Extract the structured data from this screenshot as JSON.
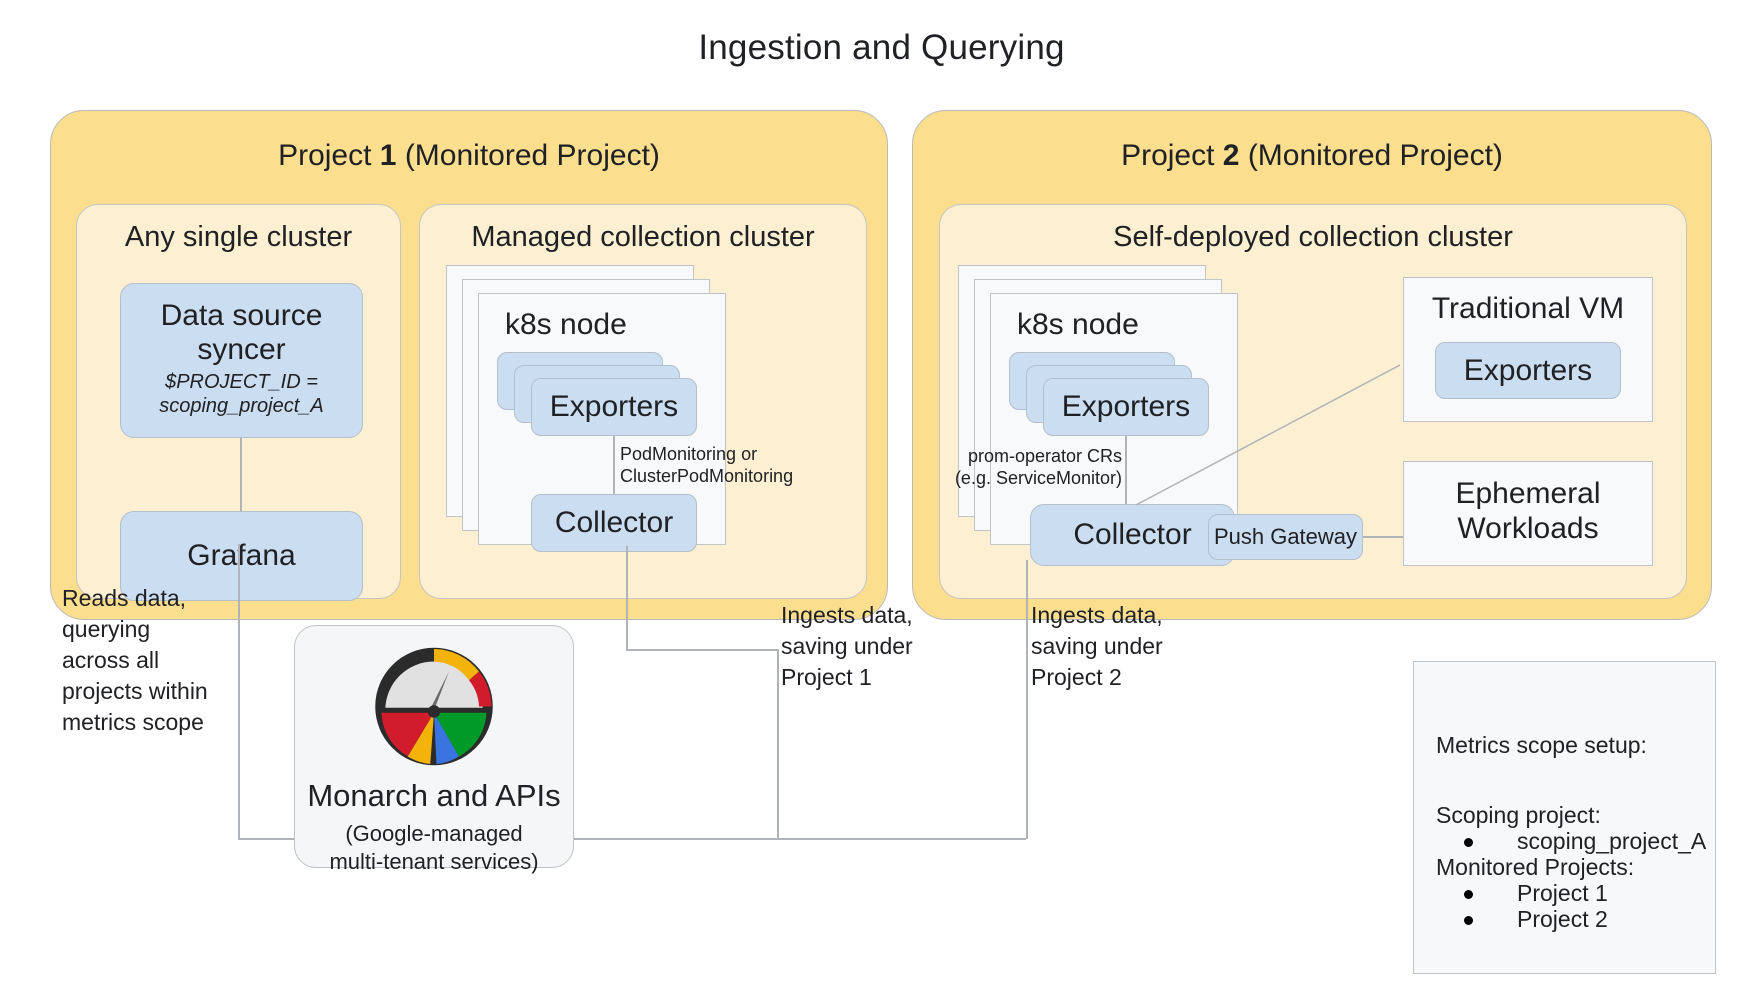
{
  "title": "Ingestion and Querying",
  "projects": [
    {
      "title_prefix": "Project ",
      "title_number": "1",
      "title_suffix": " (Monitored Project)",
      "clusters": [
        {
          "title": "Any single cluster",
          "nodes": [
            {
              "main": "Data source syncer",
              "sub": "$PROJECT_ID =\nscoping_project_A"
            },
            {
              "main": "Grafana"
            }
          ]
        },
        {
          "title": "Managed collection cluster",
          "node_card_title": "k8s node",
          "exporters_label": "Exporters",
          "collector_label": "Collector",
          "edge_label": "PodMonitoring or\nClusterPodMonitoring"
        }
      ]
    },
    {
      "title_prefix": "Project ",
      "title_number": "2",
      "title_suffix": " (Monitored Project)",
      "clusters": [
        {
          "title": "Self-deployed collection cluster",
          "node_card_title": "k8s node",
          "exporters_label": "Exporters",
          "collector_label": "Collector",
          "edge_label": "prom-operator CRs\n(e.g. ServiceMonitor)",
          "push_gateway_label": "Push Gateway",
          "vm_card_title": "Traditional VM",
          "vm_exporters_label": "Exporters",
          "ephemeral_label": "Ephemeral\nWorkloads"
        }
      ]
    }
  ],
  "captions": {
    "grafana_read": "Reads data,\nquerying\nacross all\nprojects within\nmetrics scope",
    "ingest_project1": "Ingests data,\nsaving under\nProject 1",
    "ingest_project2": "Ingests data,\nsaving under\nProject 2"
  },
  "monarch": {
    "label": "Monarch and APIs",
    "sublabel": "(Google-managed\nmulti-tenant services)"
  },
  "legend": {
    "heading": "Metrics scope setup:",
    "scoping_heading": "Scoping project:",
    "scoping_items": [
      "scoping_project_A"
    ],
    "monitored_heading": "Monitored Projects:",
    "monitored_items": [
      "Project 1",
      "Project 2"
    ]
  },
  "colors": {
    "project_panel": "#FBDF8F",
    "cluster_panel": "#FDEFD1",
    "blue_box": "#CBDDF0",
    "white_card": "#F8F9FB",
    "line": "#b0b3b7",
    "monarch_red": "#D01C2B",
    "monarch_yellow": "#F3B30B",
    "monarch_blue": "#3A74E0",
    "monarch_green": "#009A28",
    "monarch_dark": "#2B2B2B",
    "monarch_gray": "#E1E1E1"
  }
}
